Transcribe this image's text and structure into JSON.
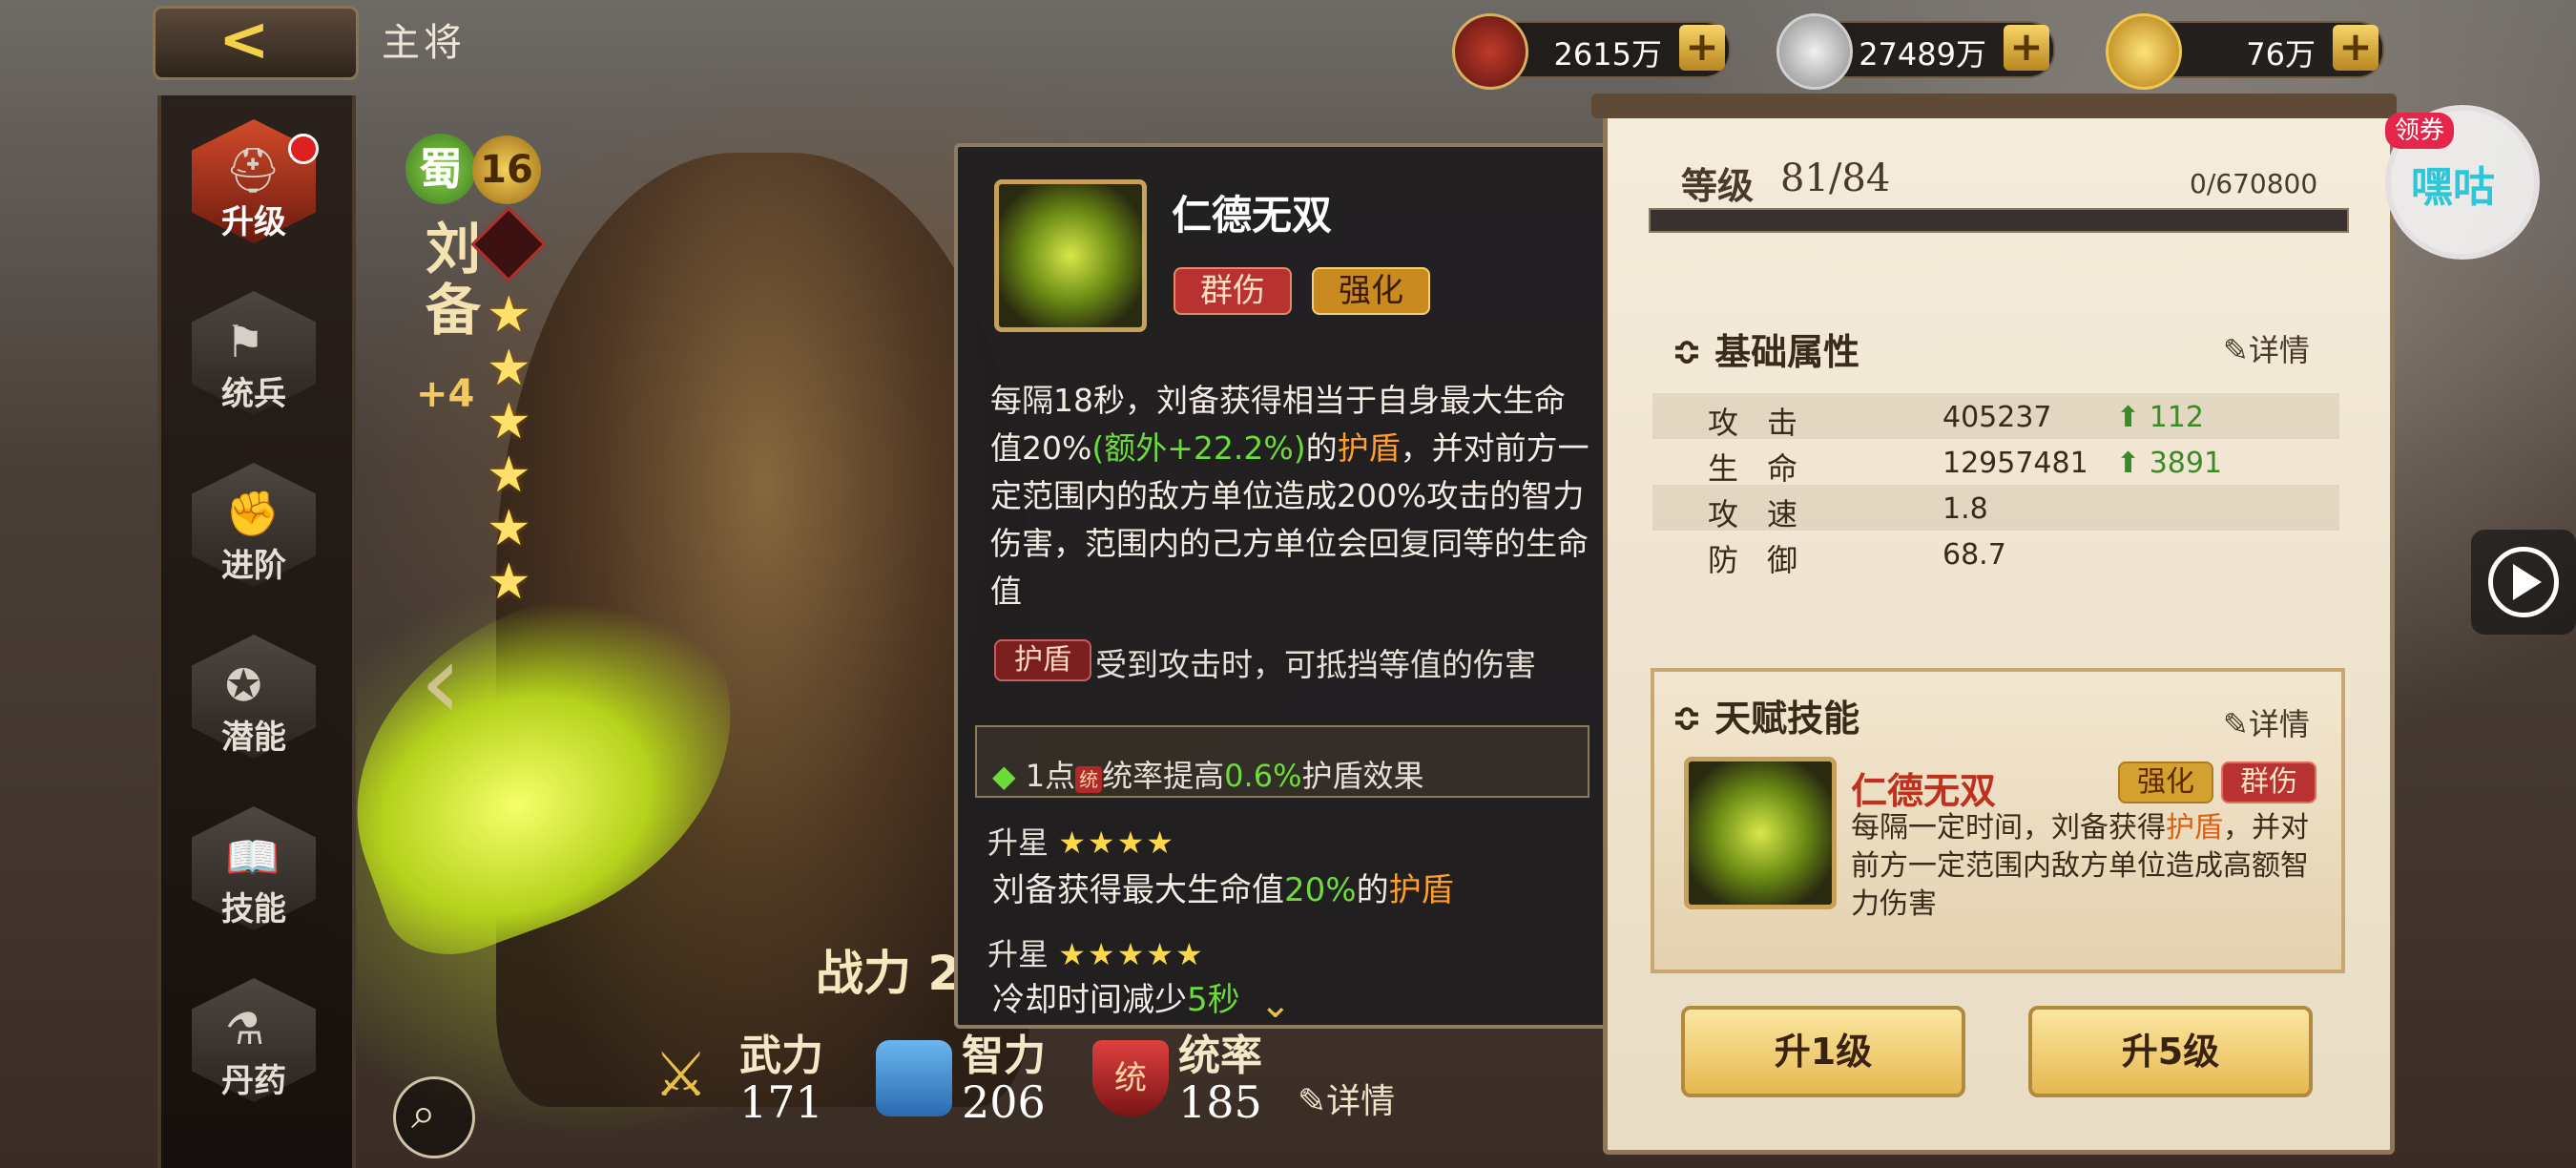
{
  "header": {
    "title": "主将",
    "resources": [
      {
        "name": "military-supplies",
        "value": "2615万"
      },
      {
        "name": "silver-coin",
        "value": "27489万"
      },
      {
        "name": "gold-ingot",
        "value": "76万"
      }
    ]
  },
  "menu": [
    {
      "label": "升级",
      "icon": "helmet-icon",
      "active": true
    },
    {
      "label": "统兵",
      "icon": "flag-icon"
    },
    {
      "label": "进阶",
      "icon": "fist-icon"
    },
    {
      "label": "潜能",
      "icon": "laurel-icon"
    },
    {
      "label": "技能",
      "icon": "book-icon"
    },
    {
      "label": "丹药",
      "icon": "potion-icon"
    }
  ],
  "hero": {
    "faction": "蜀",
    "level": "16",
    "name": "刘备",
    "plus": "+4",
    "stars": 6,
    "power_label": "战力",
    "power_value": "2"
  },
  "bottom_stats": [
    {
      "label": "武力",
      "value": "171"
    },
    {
      "label": "智力",
      "value": "206"
    },
    {
      "label": "统率",
      "value": "185"
    }
  ],
  "bottom_detail": "详情",
  "tooltip": {
    "title": "仁德无双",
    "tags": [
      "群伤",
      "强化"
    ],
    "desc_a": "每隔18秒，刘备获得相当于自身最大生命值20%",
    "desc_b": "(额外+22.2%)",
    "desc_c": "的",
    "desc_d": "护盾",
    "desc_e": "，并对前方一定范围内的敌方单位造成200%攻击的智力伤害，范围内的己方单位会回复同等的生命值",
    "shield_tag": "护盾",
    "shield_desc": "受到攻击时，可抵挡等值的伤害",
    "bonus_a": "1点",
    "bonus_badge": "统",
    "bonus_b": "统率提高",
    "bonus_c": "0.6%",
    "bonus_d": "护盾效果",
    "star4_label": "升星",
    "star4_a": "刘备获得最大生命值",
    "star4_b": "20%",
    "star4_c": "的",
    "star4_d": "护盾",
    "star5_label": "升星",
    "star5_a": "冷却时间减少",
    "star5_b": "5秒"
  },
  "panel": {
    "level_label": "等级",
    "level_value": "81/84",
    "exp": "0/670800",
    "basic_title": "基础属性",
    "detail": "详情",
    "attributes": [
      {
        "name": "攻击",
        "value": "405237",
        "bonus": "112"
      },
      {
        "name": "生命",
        "value": "12957481",
        "bonus": "3891"
      },
      {
        "name": "攻速",
        "value": "1.8",
        "bonus": ""
      },
      {
        "name": "防御",
        "value": "68.7",
        "bonus": ""
      }
    ],
    "talent_title": "天赋技能",
    "talent_detail": "详情",
    "talent_name": "仁德无双",
    "talent_tags": [
      "强化",
      "群伤"
    ],
    "talent_desc_a": "每隔一定时间，刘备获得",
    "talent_desc_b": "护盾",
    "talent_desc_c": "，并对前方一定范围内敌方单位造成高额智力伤害",
    "btn_up1": "升1级",
    "btn_up5": "升5级"
  },
  "coupon": {
    "tag": "领券",
    "text": "嘿咕"
  }
}
